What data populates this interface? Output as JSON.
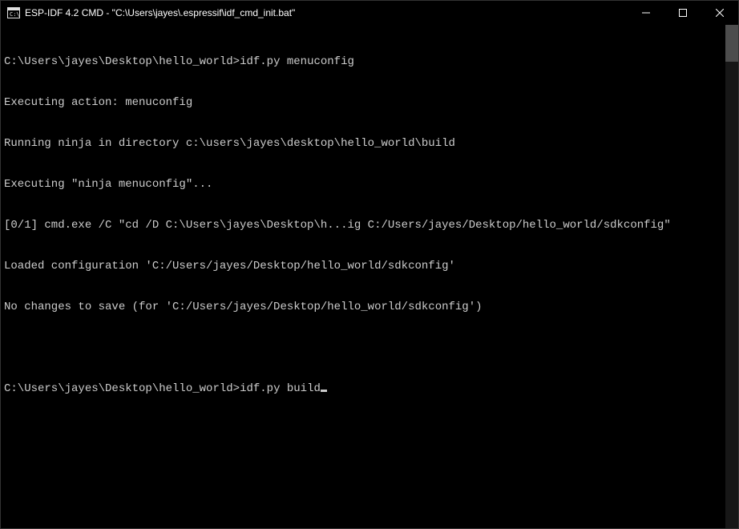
{
  "window": {
    "title": "ESP-IDF 4.2 CMD - \"C:\\Users\\jayes\\.espressif\\idf_cmd_init.bat\""
  },
  "terminal": {
    "lines": [
      {
        "prompt": "C:\\Users\\jayes\\Desktop\\hello_world>",
        "command": "idf.py menuconfig"
      },
      {
        "text": "Executing action: menuconfig"
      },
      {
        "text": "Running ninja in directory c:\\users\\jayes\\desktop\\hello_world\\build"
      },
      {
        "text": "Executing \"ninja menuconfig\"..."
      },
      {
        "text": "[0/1] cmd.exe /C \"cd /D C:\\Users\\jayes\\Desktop\\h...ig C:/Users/jayes/Desktop/hello_world/sdkconfig\""
      },
      {
        "text": "Loaded configuration 'C:/Users/jayes/Desktop/hello_world/sdkconfig'"
      },
      {
        "text": "No changes to save (for 'C:/Users/jayes/Desktop/hello_world/sdkconfig')"
      },
      {
        "text": ""
      }
    ],
    "current": {
      "prompt": "C:\\Users\\jayes\\Desktop\\hello_world>",
      "command": "idf.py build"
    }
  }
}
